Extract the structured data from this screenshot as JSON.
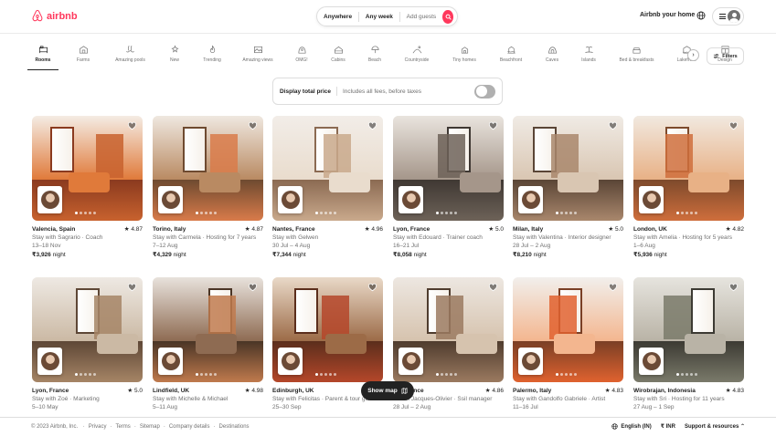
{
  "brand": {
    "name": "airbnb",
    "color": "#ff385c"
  },
  "search": {
    "where": "Anywhere",
    "when": "Any week",
    "who": "Add guests"
  },
  "header": {
    "host_link": "Airbnb your home"
  },
  "categories": [
    {
      "label": "Rooms",
      "icon": "rooms-icon",
      "active": true
    },
    {
      "label": "Farms",
      "icon": "farm-icon"
    },
    {
      "label": "Amazing pools",
      "icon": "pool-icon"
    },
    {
      "label": "New",
      "icon": "new-icon"
    },
    {
      "label": "Trending",
      "icon": "trending-icon"
    },
    {
      "label": "Amazing views",
      "icon": "views-icon"
    },
    {
      "label": "OMG!",
      "icon": "omg-icon"
    },
    {
      "label": "Cabins",
      "icon": "cabin-icon"
    },
    {
      "label": "Beach",
      "icon": "beach-icon"
    },
    {
      "label": "Countryside",
      "icon": "countryside-icon"
    },
    {
      "label": "Tiny homes",
      "icon": "tiny-home-icon"
    },
    {
      "label": "Beachfront",
      "icon": "beachfront-icon"
    },
    {
      "label": "Caves",
      "icon": "cave-icon"
    },
    {
      "label": "Islands",
      "icon": "island-icon"
    },
    {
      "label": "Bed & breakfasts",
      "icon": "bnb-icon"
    },
    {
      "label": "Lakefront",
      "icon": "lakefront-icon"
    },
    {
      "label": "Design",
      "icon": "design-icon"
    }
  ],
  "filters": {
    "label": "Filters"
  },
  "total_price": {
    "label": "Display total price",
    "sub": "Includes all fees, before taxes",
    "enabled": false
  },
  "listings": [
    {
      "title": "Valencia, Spain",
      "rating": "★ 4.87",
      "host": "Stay with Sagrario · Coach",
      "dates": "13–18 Nov",
      "price": "₹3,926",
      "unit": " night"
    },
    {
      "title": "Torino, Italy",
      "rating": "★ 4.87",
      "host": "Stay with Carmela · Hosting for 7 years",
      "dates": "7–12 Aug",
      "price": "₹4,329",
      "unit": " night"
    },
    {
      "title": "Nantes, France",
      "rating": "★ 4.96",
      "host": "Stay with Gelwen",
      "dates": "30 Jul – 4 Aug",
      "price": "₹7,344",
      "unit": " night"
    },
    {
      "title": "Lyon, France",
      "rating": "★ 5.0",
      "host": "Stay with Edouard · Trainer coach",
      "dates": "16–21 Jul",
      "price": "₹8,058",
      "unit": " night"
    },
    {
      "title": "Milan, Italy",
      "rating": "★ 5.0",
      "host": "Stay with Valentina · Interior designer",
      "dates": "28 Jul – 2 Aug",
      "price": "₹8,210",
      "unit": " night"
    },
    {
      "title": "London, UK",
      "rating": "★ 4.82",
      "host": "Stay with Amelia · Hosting for 5 years",
      "dates": "1–6 Aug",
      "price": "₹5,936",
      "unit": " night"
    },
    {
      "title": "Lyon, France",
      "rating": "★ 5.0",
      "host": "Stay with Zoé · Marketing",
      "dates": "5–10 May",
      "price": "",
      "unit": ""
    },
    {
      "title": "Lindfield, UK",
      "rating": "★ 4.98",
      "host": "Stay with Michelle & Michael",
      "dates": "5–11 Aug",
      "price": "",
      "unit": ""
    },
    {
      "title": "Edinburgh, UK",
      "rating": "★ 4.98",
      "host": "Stay with Felicitas · Parent & tour guide",
      "dates": "25–30 Sep",
      "price": "",
      "unit": ""
    },
    {
      "title": "…f, France",
      "rating": "★ 4.86",
      "host": "…with Jacques-Olivier · Ssil manager",
      "dates": "28 Jul – 2 Aug",
      "price": "",
      "unit": ""
    },
    {
      "title": "Palermo, Italy",
      "rating": "★ 4.83",
      "host": "Stay with Gandolfo Gabriele · Artist",
      "dates": "11–16 Jul",
      "price": "",
      "unit": ""
    },
    {
      "title": "Wirobrajan, Indonesia",
      "rating": "★ 4.83",
      "host": "Stay with Sri · Hosting for 11 years",
      "dates": "27 Aug – 1 Sep",
      "price": "",
      "unit": ""
    }
  ],
  "show_map": {
    "label": "Show map"
  },
  "footer": {
    "copyright": "© 2023 Airbnb, Inc.",
    "links": [
      "Privacy",
      "Terms",
      "Sitemap",
      "Company details",
      "Destinations"
    ],
    "language": "English (IN)",
    "currency": "₹ INR",
    "support": "Support & resources"
  }
}
